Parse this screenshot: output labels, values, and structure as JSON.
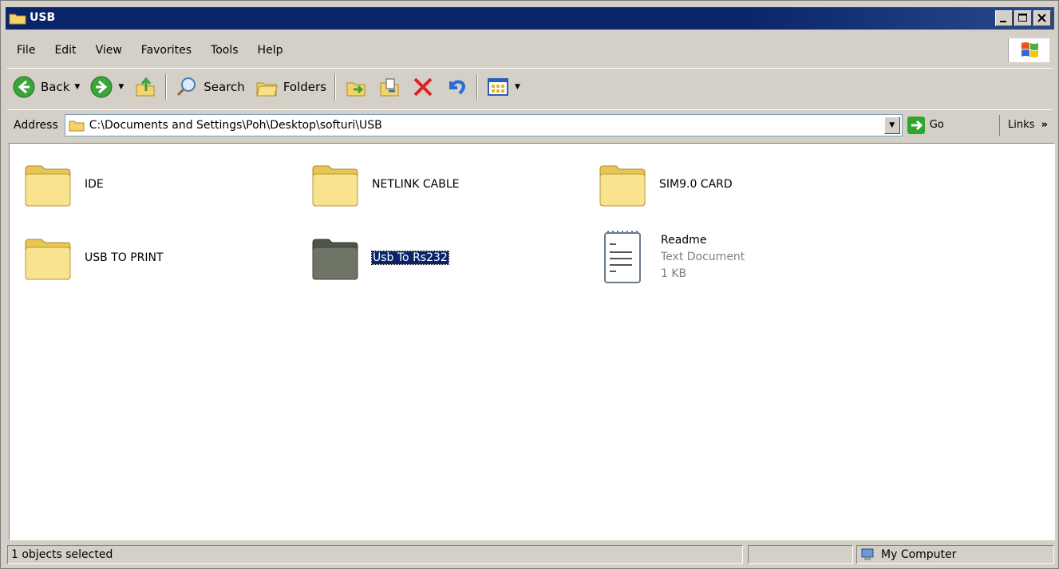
{
  "window": {
    "title": "USB"
  },
  "menu": {
    "items": [
      "File",
      "Edit",
      "View",
      "Favorites",
      "Tools",
      "Help"
    ]
  },
  "toolbar": {
    "back_label": "Back",
    "search_label": "Search",
    "folders_label": "Folders"
  },
  "address": {
    "label": "Address",
    "value": "C:\\Documents and Settings\\Poh\\Desktop\\softuri\\USB",
    "go_label": "Go",
    "links_label": "Links",
    "links_chevron": "»"
  },
  "items": [
    {
      "name": "IDE",
      "type": "folder"
    },
    {
      "name": "NETLINK CABLE",
      "type": "folder"
    },
    {
      "name": "SIM9.0 CARD",
      "type": "folder"
    },
    {
      "name": "USB TO PRINT",
      "type": "folder"
    },
    {
      "name": "Usb To Rs232",
      "type": "folder",
      "selected": true
    },
    {
      "name": "Readme",
      "type": "file",
      "kind": "Text Document",
      "size": "1 KB"
    }
  ],
  "status": {
    "selection": "1 objects selected",
    "zone": "My Computer"
  },
  "colors": {
    "title_bar": "#0a246a",
    "selection": "#0a246a",
    "window_bg": "#d4d0c8"
  }
}
